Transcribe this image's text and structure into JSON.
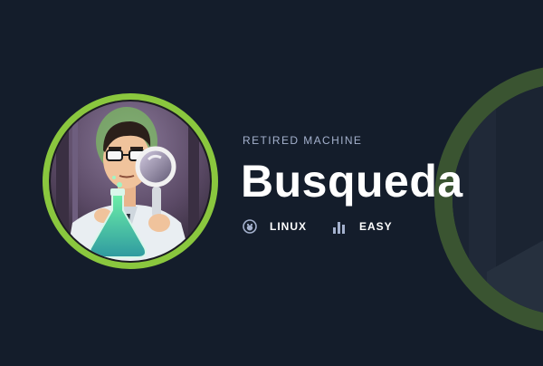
{
  "machine": {
    "status": "RETIRED MACHINE",
    "name": "Busqueda",
    "os": {
      "label": "LINUX",
      "icon": "linux-penguin-icon"
    },
    "difficulty": {
      "label": "EASY",
      "icon": "difficulty-bars-icon"
    }
  },
  "avatar": {
    "icon": "scientist-magnifier-icon",
    "ring_color": "#8ac73e"
  },
  "colors": {
    "background": "#141d2b",
    "accent": "#8ac73e",
    "subtitle": "#a4b1cd",
    "text": "#ffffff"
  }
}
